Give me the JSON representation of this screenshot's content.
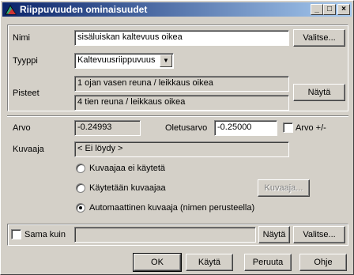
{
  "window": {
    "title": "Riippuvuuden ominaisuudet",
    "buttons": {
      "minimize": "_",
      "maximize": "□",
      "close": "×"
    }
  },
  "nimi": {
    "label": "Nimi",
    "value": "sisäluiskan kaltevuus oikea",
    "button": "Valitse..."
  },
  "tyyppi": {
    "label": "Tyyppi",
    "selected": "Kaltevuusriippuvuus"
  },
  "pisteet": {
    "label": "Pisteet",
    "point1": "1 ojan vasen reuna / leikkaus oikea",
    "point2": "4 tien reuna / leikkaus oikea",
    "button": "Näytä"
  },
  "arvo": {
    "label": "Arvo",
    "value": "-0.24993",
    "default_label": "Oletusarvo",
    "default_value": "-0.25000",
    "pm_label": "Arvo +/-"
  },
  "kuvaaja": {
    "label": "Kuvaaja",
    "value": "< Ei löydy >",
    "option1": "Kuvaajaa ei käytetä",
    "option2": "Käytetään kuvaajaa",
    "option3": "Automaattinen kuvaaja (nimen perusteella)",
    "button": "Kuvaaja..."
  },
  "sama": {
    "label": "Sama kuin",
    "value": "",
    "show": "Näytä",
    "select": "Valitse..."
  },
  "footer": {
    "ok": "OK",
    "apply": "Käytä",
    "cancel": "Peruuta",
    "help": "Ohje"
  }
}
